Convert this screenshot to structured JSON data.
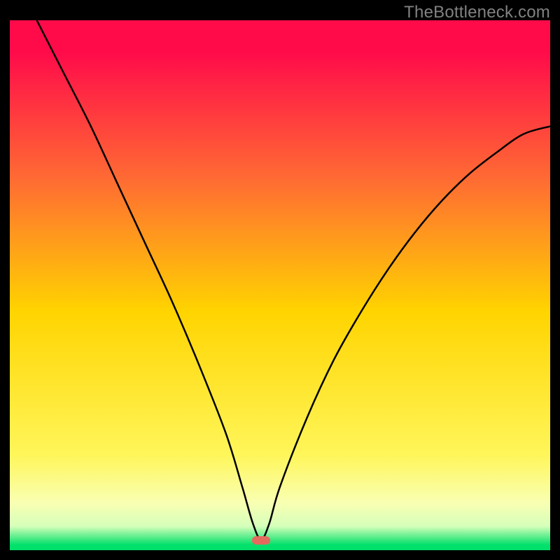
{
  "watermark": "TheBottleneck.com",
  "colors": {
    "gradient_top": "#ff0b4a",
    "gradient_mid": "#ffd400",
    "gradient_lower": "#fff65a",
    "gradient_bottom": "#00e06a",
    "curve": "#000000",
    "marker": "#e46a5e",
    "frame_bg": "#000000"
  },
  "marker": {
    "x_percent": 46.5,
    "y_percent": 98.1
  },
  "chart_data": {
    "type": "line",
    "title": "",
    "xlabel": "",
    "ylabel": "",
    "xlim": [
      0,
      100
    ],
    "ylim": [
      0,
      100
    ],
    "series": [
      {
        "name": "bottleneck-curve",
        "x": [
          5,
          10,
          15,
          20,
          25,
          30,
          35,
          40,
          43,
          45,
          46.5,
          48,
          50,
          55,
          60,
          65,
          70,
          75,
          80,
          85,
          90,
          95,
          100
        ],
        "y": [
          100,
          90,
          80,
          69,
          58,
          47,
          35,
          22,
          12,
          5,
          2,
          5,
          12,
          25,
          36,
          45,
          53,
          60,
          66,
          71,
          75,
          78.5,
          80
        ]
      }
    ],
    "annotations": [
      {
        "name": "min-marker",
        "x": 46.5,
        "y": 2
      }
    ]
  }
}
